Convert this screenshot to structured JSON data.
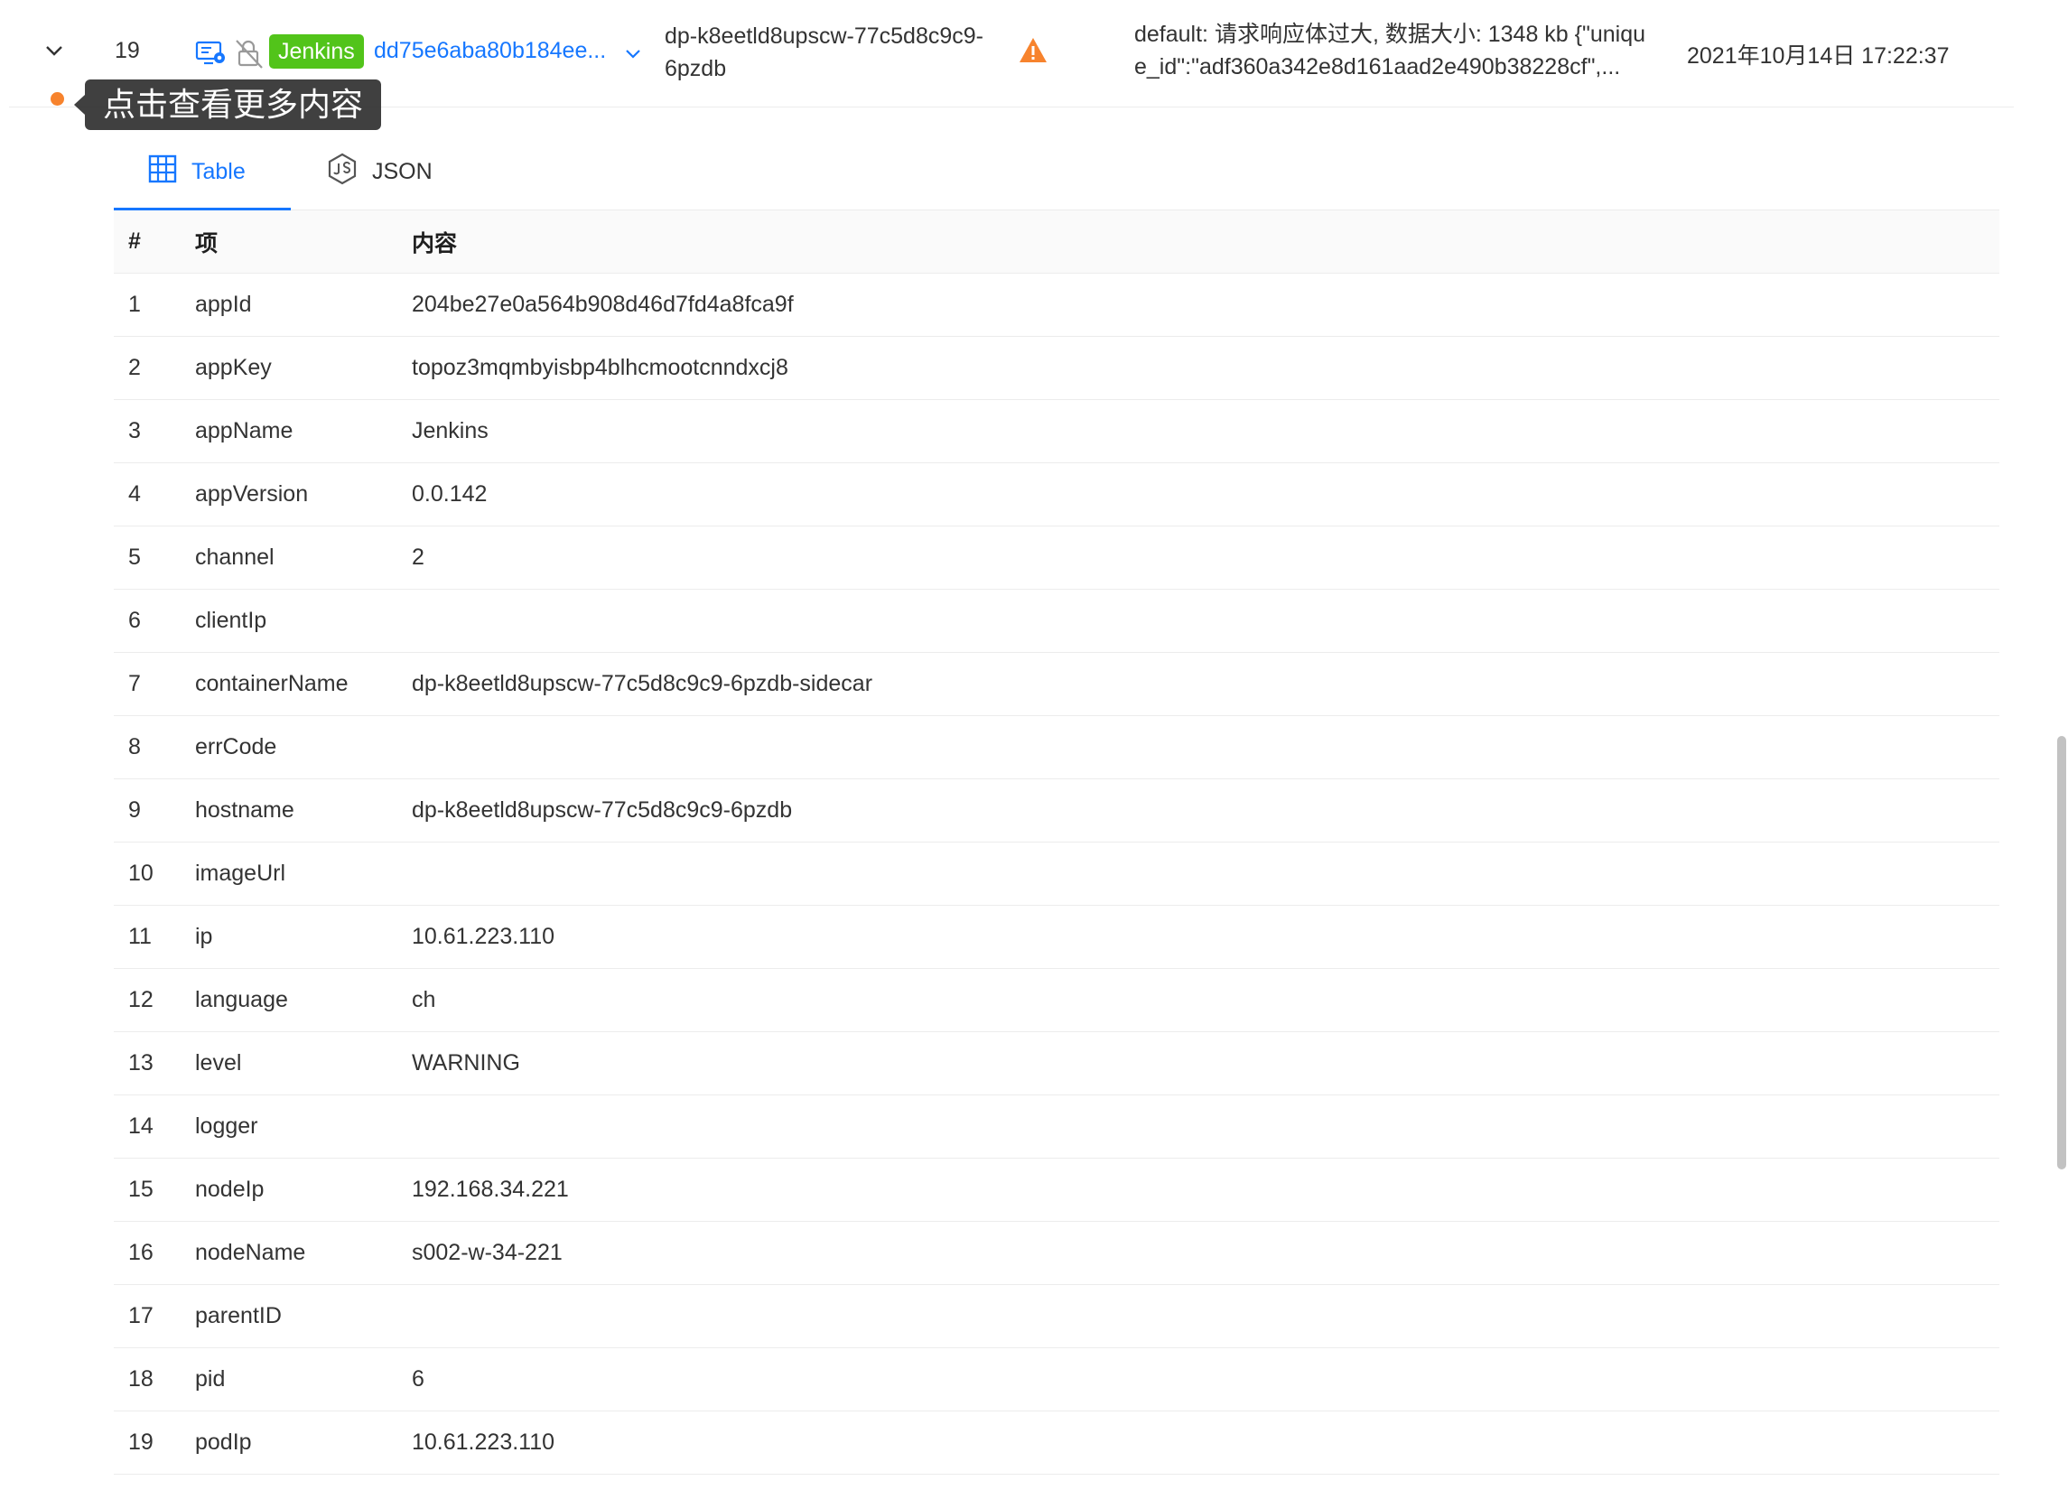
{
  "log_row": {
    "index": "19",
    "app_tag": "Jenkins",
    "trace_id": "dd75e6aba80b184ee...",
    "pod_name": "dp-k8eetld8upscw-77c5d8c9c9-6pzdb",
    "message_line1": "default: 请求响应体过大, 数据大小: 1348 kb {\"uniqu",
    "message_line2": "e_id\":\"adf360a342e8d161aad2e490b38228cf\",...",
    "timestamp": "2021年10月14日 17:22:37",
    "level_color": "#f7832d",
    "tag_color": "#52c41a",
    "link_color": "#1677ff"
  },
  "tooltip": {
    "text": "点击查看更多内容"
  },
  "tabs": {
    "table_label": "Table",
    "json_label": "JSON"
  },
  "table": {
    "headers": {
      "index": "#",
      "key": "项",
      "value": "内容"
    },
    "rows": [
      {
        "index": "1",
        "key": "appId",
        "value": "204be27e0a564b908d46d7fd4a8fca9f"
      },
      {
        "index": "2",
        "key": "appKey",
        "value": "topoz3mqmbyisbp4blhcmootcnndxcj8"
      },
      {
        "index": "3",
        "key": "appName",
        "value": "Jenkins"
      },
      {
        "index": "4",
        "key": "appVersion",
        "value": "0.0.142"
      },
      {
        "index": "5",
        "key": "channel",
        "value": "2"
      },
      {
        "index": "6",
        "key": "clientIp",
        "value": ""
      },
      {
        "index": "7",
        "key": "containerName",
        "value": "dp-k8eetld8upscw-77c5d8c9c9-6pzdb-sidecar"
      },
      {
        "index": "8",
        "key": "errCode",
        "value": ""
      },
      {
        "index": "9",
        "key": "hostname",
        "value": "dp-k8eetld8upscw-77c5d8c9c9-6pzdb"
      },
      {
        "index": "10",
        "key": "imageUrl",
        "value": ""
      },
      {
        "index": "11",
        "key": "ip",
        "value": "10.61.223.110"
      },
      {
        "index": "12",
        "key": "language",
        "value": "ch"
      },
      {
        "index": "13",
        "key": "level",
        "value": "WARNING"
      },
      {
        "index": "14",
        "key": "logger",
        "value": ""
      },
      {
        "index": "15",
        "key": "nodeIp",
        "value": "192.168.34.221"
      },
      {
        "index": "16",
        "key": "nodeName",
        "value": "s002-w-34-221"
      },
      {
        "index": "17",
        "key": "parentID",
        "value": ""
      },
      {
        "index": "18",
        "key": "pid",
        "value": "6"
      },
      {
        "index": "19",
        "key": "podIp",
        "value": "10.61.223.110"
      }
    ]
  }
}
